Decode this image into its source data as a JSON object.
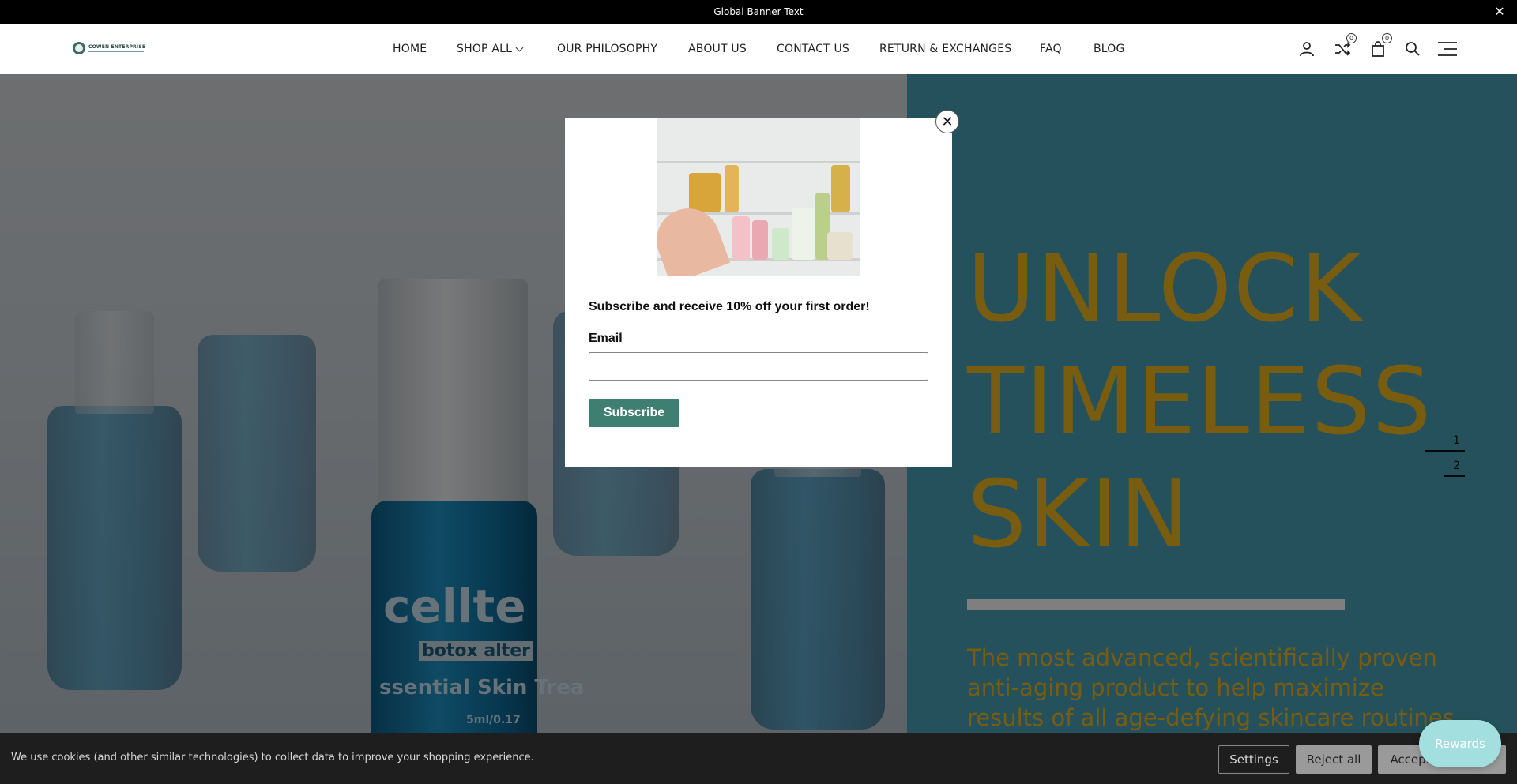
{
  "banner": {
    "text": "Global Banner Text",
    "close_symbol": "✕"
  },
  "logo": {
    "text": "COWEN ENTERPRISE"
  },
  "nav": {
    "items": [
      {
        "label": "HOME"
      },
      {
        "label": "SHOP ALL",
        "has_dropdown": true
      },
      {
        "label": "OUR PHILOSOPHY"
      },
      {
        "label": "ABOUT US"
      },
      {
        "label": "CONTACT US"
      },
      {
        "label": "RETURN & EXCHANGES"
      },
      {
        "label": "FAQ"
      },
      {
        "label": "BLOG"
      }
    ]
  },
  "header_icons": {
    "account": "user-icon",
    "compare": "shuffle-icon",
    "compare_count": "0",
    "cart": "bag-icon",
    "cart_count": "0",
    "search": "search-icon",
    "menu": "hamburger-icon"
  },
  "hero": {
    "title_lines": [
      "UNLOCK",
      "TIMELESS",
      "SKIN"
    ],
    "subtitle": "The most advanced, scientifically proven anti-aging product to help maximize results of all age-defying skincare routines",
    "product_label_brand": "cellte",
    "product_label_sub": "botox alter",
    "product_label_desc": "ssential Skin Trea",
    "product_label_size": "5ml/0.17",
    "slides": [
      "1",
      "2"
    ],
    "colors": {
      "panel": "#4aa3b9",
      "title": "#f0b820"
    }
  },
  "popup": {
    "heading": "Subscribe and receive 10% off your first order!",
    "email_label": "Email",
    "email_placeholder": "",
    "subscribe_label": "Subscribe",
    "close_symbol": "✕",
    "button_color": "#3f7f72"
  },
  "cookie": {
    "text": "We use cookies (and other similar technologies) to collect data to improve your shopping experience.",
    "settings_label": "Settings",
    "reject_label": "Reject all",
    "accept_label": "Accept"
  },
  "rewards": {
    "label": "Rewards"
  }
}
